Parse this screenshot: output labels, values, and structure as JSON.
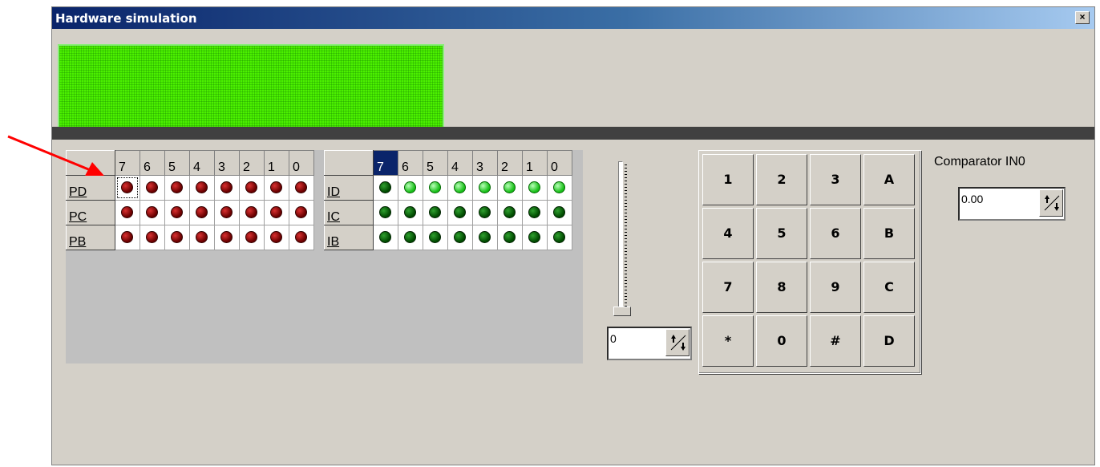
{
  "window": {
    "title": "Hardware simulation",
    "close_label": "×"
  },
  "ports": {
    "bit_headers": [
      "7",
      "6",
      "5",
      "4",
      "3",
      "2",
      "1",
      "0"
    ],
    "output_rows": [
      {
        "label": "PD",
        "states": [
          "off",
          "off",
          "off",
          "off",
          "off",
          "off",
          "off",
          "off"
        ]
      },
      {
        "label": "PC",
        "states": [
          "off",
          "off",
          "off",
          "off",
          "off",
          "off",
          "off",
          "off"
        ]
      },
      {
        "label": "PB",
        "states": [
          "off",
          "off",
          "off",
          "off",
          "off",
          "off",
          "off",
          "off"
        ]
      }
    ],
    "input_rows": [
      {
        "label": "ID",
        "states": [
          "off",
          "on",
          "on",
          "on",
          "on",
          "on",
          "on",
          "on"
        ]
      },
      {
        "label": "IC",
        "states": [
          "off",
          "off",
          "off",
          "off",
          "off",
          "off",
          "off",
          "off"
        ]
      },
      {
        "label": "IB",
        "states": [
          "off",
          "off",
          "off",
          "off",
          "off",
          "off",
          "off",
          "off"
        ]
      }
    ],
    "input_selected_header": "7",
    "colors": {
      "output_led": "#8b0000",
      "input_led_off": "#006400",
      "input_led_on": "#33dd33"
    }
  },
  "slider": {
    "value_display": "0",
    "level": 0
  },
  "keypad": {
    "keys": [
      "1",
      "2",
      "3",
      "A",
      "4",
      "5",
      "6",
      "B",
      "7",
      "8",
      "9",
      "C",
      "*",
      "0",
      "#",
      "D"
    ]
  },
  "comparator": {
    "label": "Comparator IN0",
    "value": "0.00"
  },
  "colors": {
    "lcd_background": "#4cf000",
    "title_bar": "#0a246a",
    "dialog_face": "#d4d0c8"
  }
}
